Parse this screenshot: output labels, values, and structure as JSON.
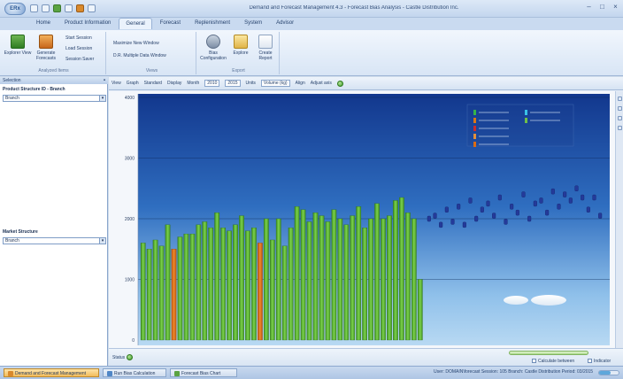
{
  "app": {
    "title": "Demand and Forecast Management 4.3 - Forecast Bias Analysis - Castle Distribution Inc.",
    "orb_label": "ERx"
  },
  "ribbon_tabs": [
    "Home",
    "Product Information",
    "General",
    "Forecast",
    "Replenishment",
    "System",
    "Advisor"
  ],
  "ribbon_active_tab": 2,
  "ribbon": {
    "groups": [
      {
        "label": "Analyzed Items"
      },
      {
        "label": "Views"
      },
      {
        "label": "Export"
      }
    ],
    "buttons": {
      "explorer": "Explorer View",
      "generate": "Generate Forecasts",
      "start": "Start Session",
      "load": "Load Session",
      "session": "Session Saver",
      "new_window": "Maximize New Window",
      "window_2": "D.R. Multiple Data Window",
      "bias": "Bias Configuration",
      "explore": "Explore",
      "create": "Create Report"
    }
  },
  "left_panel": {
    "header": "Selection",
    "product_label": "Product Structure ID - Branch",
    "product_value": "Branch",
    "market_label": "Market Structure",
    "market_value": "Branch"
  },
  "chart_toolbar": {
    "view_label": "View",
    "graph_label": "Graph",
    "graph_value": "Standard",
    "display_label": "Display",
    "month_label": "Month",
    "from_value": "2010",
    "to_value": "2015",
    "units_label": "Units",
    "units_value": "Volume (kg)",
    "align_label": "Align",
    "adjust_label": "Adjust axis"
  },
  "chart_data": {
    "type": "bar",
    "ylim": [
      0,
      4000
    ],
    "yticks": [
      "0",
      "1000",
      "2000",
      "3000",
      "4000"
    ],
    "legend_colors": [
      "#34b44a",
      "#d97816",
      "#c62d2d",
      "#e2903a",
      "#39c1e8",
      "#6fbf4a",
      "#d96b14"
    ],
    "history_values": [
      1600,
      1500,
      1650,
      1550,
      1900,
      1500,
      1700,
      1750,
      1750,
      1900,
      1950,
      1850,
      2100,
      1850,
      1800,
      1900,
      2050,
      1800,
      1850,
      1600,
      2000,
      1650,
      2000,
      1550,
      1850,
      2200,
      2150,
      1950,
      2100,
      2050,
      1950,
      2150,
      2000,
      1900,
      2050,
      2200,
      1850,
      2000,
      2250,
      2000,
      2050,
      2300,
      2350,
      2100,
      2000,
      1000
    ],
    "history_colors": [
      "g",
      "g",
      "g",
      "g",
      "g",
      "o",
      "g",
      "g",
      "g",
      "g",
      "g",
      "g",
      "g",
      "g",
      "g",
      "g",
      "g",
      "g",
      "g",
      "o",
      "g",
      "g",
      "g",
      "g",
      "g",
      "g",
      "g",
      "g",
      "g",
      "g",
      "g",
      "g",
      "g",
      "g",
      "g",
      "g",
      "g",
      "g",
      "g",
      "g",
      "g",
      "g",
      "g",
      "g",
      "g",
      "g"
    ],
    "forecast_values": [
      2000,
      2050,
      1900,
      2150,
      1950,
      2200,
      1900,
      2300,
      2000,
      2150,
      2250,
      2050,
      2350,
      1950,
      2200,
      2100,
      2400,
      2000,
      2250,
      2300,
      2100,
      2450,
      2200,
      2400,
      2300,
      2500,
      2350,
      2150,
      2350,
      2050
    ]
  },
  "chart_footer": {
    "status_label": "Status",
    "check1": "Calculate between",
    "check2": "Indicator"
  },
  "statusbar": {
    "tab1": "Demand and Forecast Management",
    "tab2": "Run Bias Calculation",
    "tab3": "Forecast Bias Chart",
    "right_text": "User: DOMAIN\\forecast  Session: 105  Branch: Castle Distribution  Period: 03/2015"
  }
}
